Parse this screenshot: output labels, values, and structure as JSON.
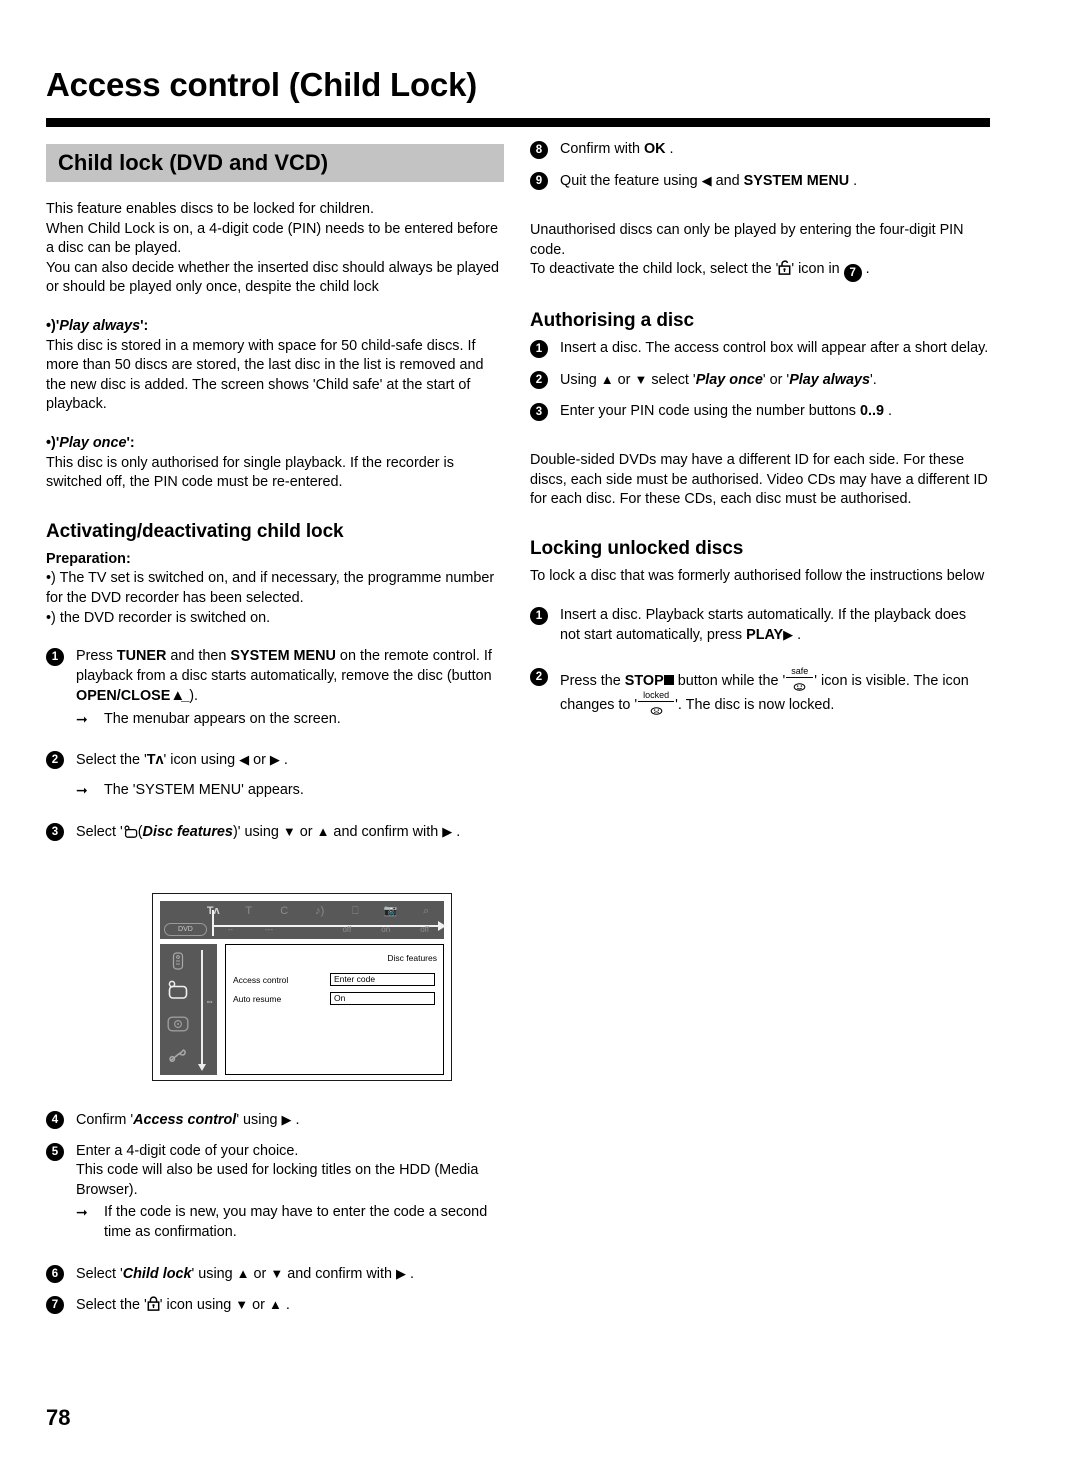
{
  "header": {
    "title": "Access control (Child Lock)"
  },
  "banner": {
    "title": "Child lock (DVD and VCD)"
  },
  "page_number": "78",
  "left_column": {
    "intro": [
      "This feature enables discs to be locked for children.",
      "When Child Lock is on, a 4-digit code (PIN) needs to be entered before a disc can be played.",
      "You can also decide whether the inserted disc should always be played or should be played only once, despite the child lock"
    ],
    "play_always": {
      "bullet": "•)",
      "label": "Play always",
      "body": "This disc is stored in a memory with space for 50 child-safe discs. If more than 50 discs are stored, the last disc in the list is removed and the new disc is added. The screen shows 'Child safe' at the start of playback."
    },
    "play_once": {
      "bullet": "•)",
      "label": "Play once",
      "body": "This disc is only authorised for single playback. If the recorder is switched off, the PIN code must be re-entered."
    },
    "activating": {
      "heading": "Activating/deactivating child lock",
      "preparation_label": "Preparation:",
      "preparation_items": [
        "•) The TV set is switched on, and if necessary, the programme number for the DVD recorder has been selected.",
        "•) the DVD recorder is switched on."
      ],
      "steps": [
        {
          "num": "1",
          "text_1": "Press ",
          "bold_1": "TUNER",
          "text_2": " and then ",
          "bold_2": "SYSTEM MENU",
          "text_3": " on the remote control. If playback from a disc starts automatically, remove the disc (button ",
          "bold_3": "OPEN/CLOSE",
          "text_4": " ).",
          "result": "The menubar appears on the screen."
        },
        {
          "num": "2",
          "text_1": "Select the '",
          "icon": "tuner-icon",
          "text_2": "' icon using ",
          "text_3": " or ",
          "text_4": " .",
          "result": "The 'SYSTEM MENU' appears."
        },
        {
          "num": "3",
          "text_1": "Select '",
          "icon": "disc-features-icon",
          "text_2": "(",
          "italic": "Disc features",
          "text_3": ")' using ",
          "text_4": " or ",
          "text_5": " and confirm with ",
          "text_6": " ."
        },
        {
          "num": "4",
          "text_1": "Confirm '",
          "italic": "Access control",
          "text_2": "' using ",
          "text_3": " ."
        },
        {
          "num": "5",
          "text_1": "Enter a 4-digit code of your choice.",
          "text_2": "This code will also be used for locking titles on the HDD (Media Browser).",
          "result": "If the code is new, you may have to enter the code a second time as confirmation."
        },
        {
          "num": "6",
          "text_1": "Select '",
          "italic": "Child lock",
          "text_2": "' using ",
          "text_3": " or ",
          "text_4": " and confirm with ",
          "text_5": " ."
        },
        {
          "num": "7",
          "text_1": "Select the '",
          "icon": "padlock-closed-icon",
          "text_2": "' icon using ",
          "text_3": " or ",
          "text_4": " ."
        }
      ]
    },
    "tv_screen": {
      "menubar_top": [
        "Tʎ",
        "T",
        "C",
        "sound-icon",
        "subtitle-icon",
        "camera-icon",
        "zoom-icon"
      ],
      "menubar_bottom": [
        "dvd-logo",
        "--",
        "---",
        "",
        "off",
        "on",
        "off"
      ],
      "sidebar_icons": [
        "remote-icon",
        "disc-features-icon",
        "disc-icon",
        "wrench-icon"
      ],
      "panel_title": "Disc features",
      "rows": [
        {
          "label": "Access control",
          "value": "Enter code"
        },
        {
          "label": "Auto resume",
          "value": "On"
        }
      ]
    }
  },
  "right_column": {
    "steps_top": [
      {
        "num": "8",
        "text_1": "Confirm with ",
        "bold_1": "OK",
        "text_2": " ."
      },
      {
        "num": "9",
        "text_1": "Quit the feature using ",
        "text_2": " and ",
        "bold_1": "SYSTEM MENU",
        "text_3": " ."
      }
    ],
    "note_top": {
      "line_1": "Unauthorised discs can only be played by entering the four-digit PIN code.",
      "line_2_a": "To deactivate the child lock, select the '",
      "icon": "padlock-open-icon",
      "line_2_b": "' icon in ",
      "ref_num": "7",
      "line_2_c": " ."
    },
    "authorising": {
      "heading": "Authorising a disc",
      "steps": [
        {
          "num": "1",
          "text_1": "Insert a disc. The access control box will appear after a short delay."
        },
        {
          "num": "2",
          "text_1": "Using ",
          "text_2": " or ",
          "text_3": " select '",
          "italic_1": "Play once",
          "text_4": "' or '",
          "italic_2": "Play always",
          "text_5": "'."
        },
        {
          "num": "3",
          "text_1": "Enter your PIN code using the number buttons ",
          "bold_1": "0..9",
          "text_2": " ."
        }
      ],
      "note": "Double-sided DVDs may have a different ID for each side. For these discs, each side must be authorised. Video CDs may have a different ID for each disc. For these CDs, each disc must be authorised."
    },
    "locking": {
      "heading": "Locking unlocked discs",
      "intro": "To lock a disc that was formerly authorised follow the instructions below",
      "steps": [
        {
          "num": "1",
          "text_1": "Insert a disc. Playback starts automatically. If the playback does not start automatically, press ",
          "bold_1": "PLAY",
          "text_2": " ."
        },
        {
          "num": "2",
          "text_1": "Press the ",
          "bold_1": "STOP",
          "text_2": " button while the '",
          "icon_1": "safe",
          "text_3": "' icon is visible. The icon changes to '",
          "icon_2": "locked",
          "text_4": "'. The disc is now locked."
        }
      ]
    }
  },
  "colors": {
    "banner_gray": "#c3c3c3",
    "rule_black": "#000000",
    "tv_menubar_gray": "#585858"
  }
}
